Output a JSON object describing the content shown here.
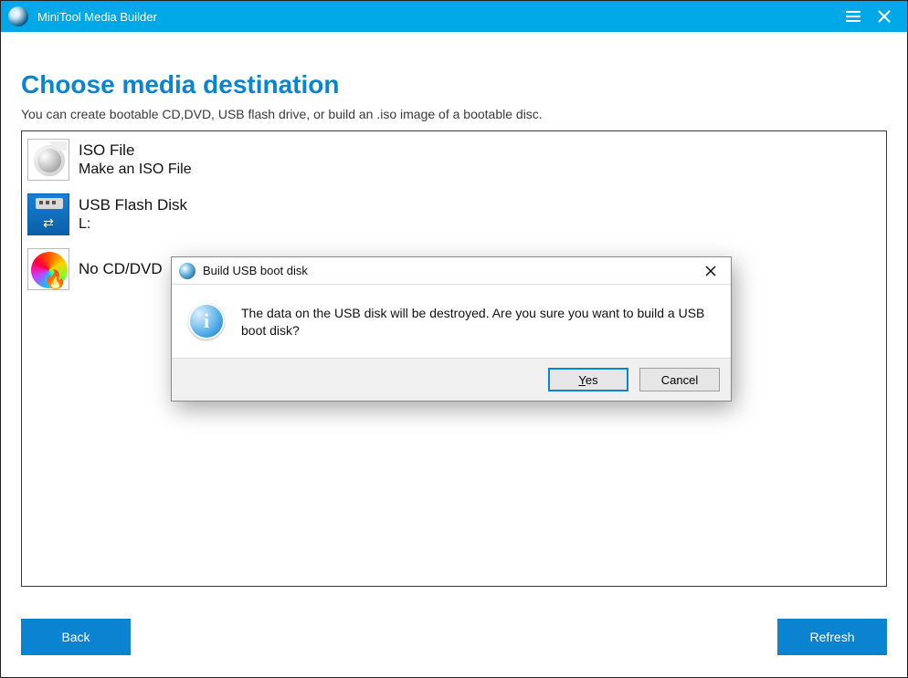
{
  "titlebar": {
    "app_name": "MiniTool Media Builder"
  },
  "page": {
    "heading": "Choose media destination",
    "subheading": "You can create bootable CD,DVD, USB flash drive, or build an .iso image of a bootable disc."
  },
  "options": [
    {
      "title": "ISO File",
      "subtitle": "Make an ISO File"
    },
    {
      "title": "USB Flash Disk",
      "subtitle": "L:"
    },
    {
      "title": "No CD/DVD",
      "subtitle": ""
    }
  ],
  "footer": {
    "back_label": "Back",
    "refresh_label": "Refresh"
  },
  "dialog": {
    "title": "Build USB boot disk",
    "message": "The data on the USB disk will be destroyed. Are you sure you want to build a USB boot disk?",
    "yes_label_prefix": "Y",
    "yes_label_rest": "es",
    "cancel_label": "Cancel"
  }
}
